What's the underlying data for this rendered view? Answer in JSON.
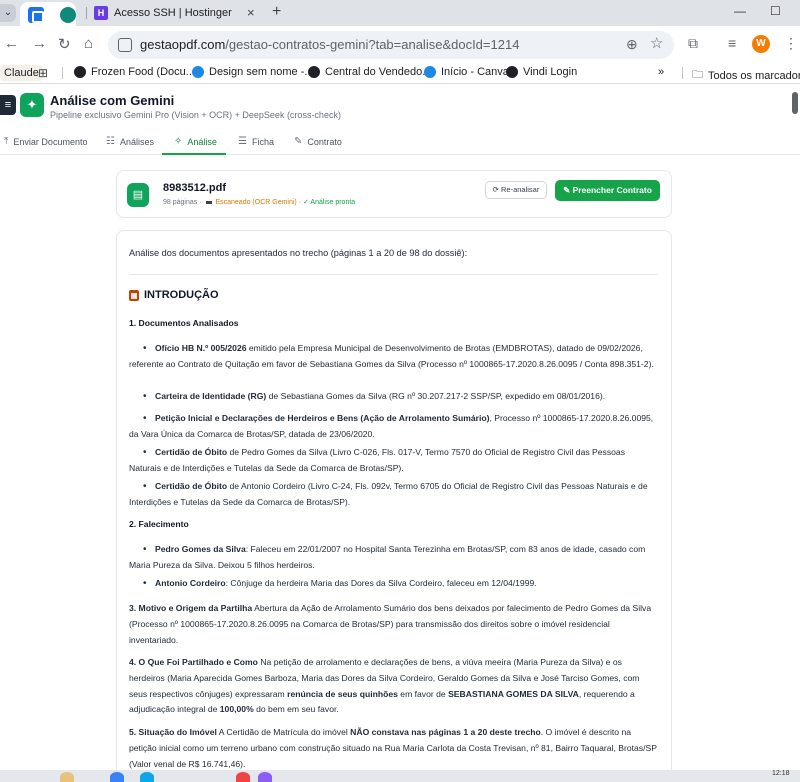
{
  "browser": {
    "tab_title": "Acesso SSH | Hostinger",
    "url_domain": "gestaopdf.com",
    "url_path": "/gestao-contratos-gemini?tab=analise&docId=1214",
    "profile_initial": "W",
    "bookmarks": [
      {
        "label": "Claude"
      },
      {
        "label": "Frozen Food (Docu..."
      },
      {
        "label": "Design sem nome -..."
      },
      {
        "label": "Central do Vendedo..."
      },
      {
        "label": "Início - Canva"
      },
      {
        "label": "Vindi Login"
      }
    ],
    "all_bookmarks_label": "Todos os marcadores",
    "chevron": "»",
    "tray_time": "12:18"
  },
  "app": {
    "title": "Análise com Gemini",
    "subtitle": "Pipeline exclusivo Gemini Pro (Vision + OCR) + DeepSeek (cross-check)",
    "tabs": [
      {
        "label": "Enviar Documento",
        "icon": "upload-icon"
      },
      {
        "label": "Análises",
        "icon": "list-icon"
      },
      {
        "label": "Análise",
        "icon": "sparkle-icon",
        "active": true
      },
      {
        "label": "Ficha",
        "icon": "form-icon"
      },
      {
        "label": "Contrato",
        "icon": "contract-icon"
      }
    ]
  },
  "file": {
    "name": "8983512.pdf",
    "pages": "98 páginas",
    "scan_status": "Escaneado (OCR Gemini)",
    "analysis_status": "✓ Análise pronta",
    "reanalyze_label": "Re-analisar",
    "fill_contract_label": "Preencher Contrato"
  },
  "analysis": {
    "intro": "Análise dos documentos apresentados no trecho (páginas 1 a 20 de 98 do dossiê):",
    "section_title": "INTRODUÇÃO",
    "h1": "1. Documentos Analisados",
    "docs": [
      {
        "bold": "Ofício HB N.º 005/2026",
        "text": " emitido pela Empresa Municipal de Desenvolvimento de Brotas (EMDBROTAS), datado de 09/02/2026, referente ao Contrato de Quitação em favor de Sebastiana Gomes da Silva (Processo nº 1000865-17.2020.8.26.0095 / Conta 898.351-2)."
      },
      {
        "bold": "Carteira de Identidade (RG)",
        "text": " de Sebastiana Gomes da Silva (RG nº 30.207.217-2 SSP/SP, expedido em 08/01/2016)."
      },
      {
        "bold": "Petição Inicial e Declarações de Herdeiros e Bens (Ação de Arrolamento Sumário)",
        "text": ", Processo nº 1000865-17.2020.8.26.0095, da Vara Única da Comarca de Brotas/SP, datada de 23/06/2020."
      },
      {
        "bold": "Certidão de Óbito",
        "text": " de Pedro Gomes da Silva (Livro C-026, Fls. 017-V, Termo 7570 do Oficial de Registro Civil das Pessoas Naturais e de Interdições e Tutelas da Sede da Comarca de Brotas/SP)."
      },
      {
        "bold": "Certidão de Óbito",
        "text": " de Antonio Cordeiro (Livro C-24, Fls. 092v, Termo 6705 do Oficial de Registro Civil das Pessoas Naturais e de Interdições e Tutelas da Sede da Comarca de Brotas/SP)."
      }
    ],
    "h2": "2. Falecimento",
    "deaths": [
      {
        "bold": "Pedro Gomes da Silva",
        "text": ": Faleceu em 22/01/2007 no Hospital Santa Terezinha em Brotas/SP, com 83 anos de idade, casado com Maria Pureza da Silva. Deixou 5 filhos herdeiros."
      },
      {
        "bold": "Antonio Cordeiro",
        "text": ": Cônjuge da herdeira Maria das Dores da Silva Cordeiro, faleceu em 12/04/1999."
      }
    ],
    "p3_bold": "3. Motivo e Origem da Partilha",
    "p3_text": " Abertura da Ação de Arrolamento Sumário dos bens deixados por falecimento de Pedro Gomes da Silva (Processo nº 1000865-17.2020.8.26.0095 na Comarca de Brotas/SP) para transmissão dos direitos sobre o imóvel residencial inventariado.",
    "p4_bold": "4. O Que Foi Partilhado e Como",
    "p4_text_a": " Na petição de arrolamento e declarações de bens, a viúva meeira (Maria Pureza da Silva) e os herdeiros (Maria Aparecida Gomes Barboza, Maria das Dores da Silva Cordeiro, Geraldo Gomes da Silva e José Tarciso Gomes, com seus respectivos cônjuges) expressaram ",
    "p4_bold_b": "renúncia de seus quinhões",
    "p4_text_c": " em favor de ",
    "p4_bold_d": "SEBASTIANA GOMES DA SILVA",
    "p4_text_e": ", requerendo a adjudicação integral de ",
    "p4_bold_f": "100,00%",
    "p4_text_g": " do bem em seu favor.",
    "p5_bold": "5. Situação do Imóvel",
    "p5_text_a": " A Certidão de Matrícula do imóvel ",
    "p5_bold_b": "NÃO constava nas páginas 1 a 20 deste trecho",
    "p5_text_c": ". O imóvel é descrito na petição inicial como um terreno urbano com construção situado na Rua Maria Carlota da Costa Trevisan, nº 81, Bairro Taquaral, Brotas/SP (Valor venal de R$ 16.741,46)."
  }
}
